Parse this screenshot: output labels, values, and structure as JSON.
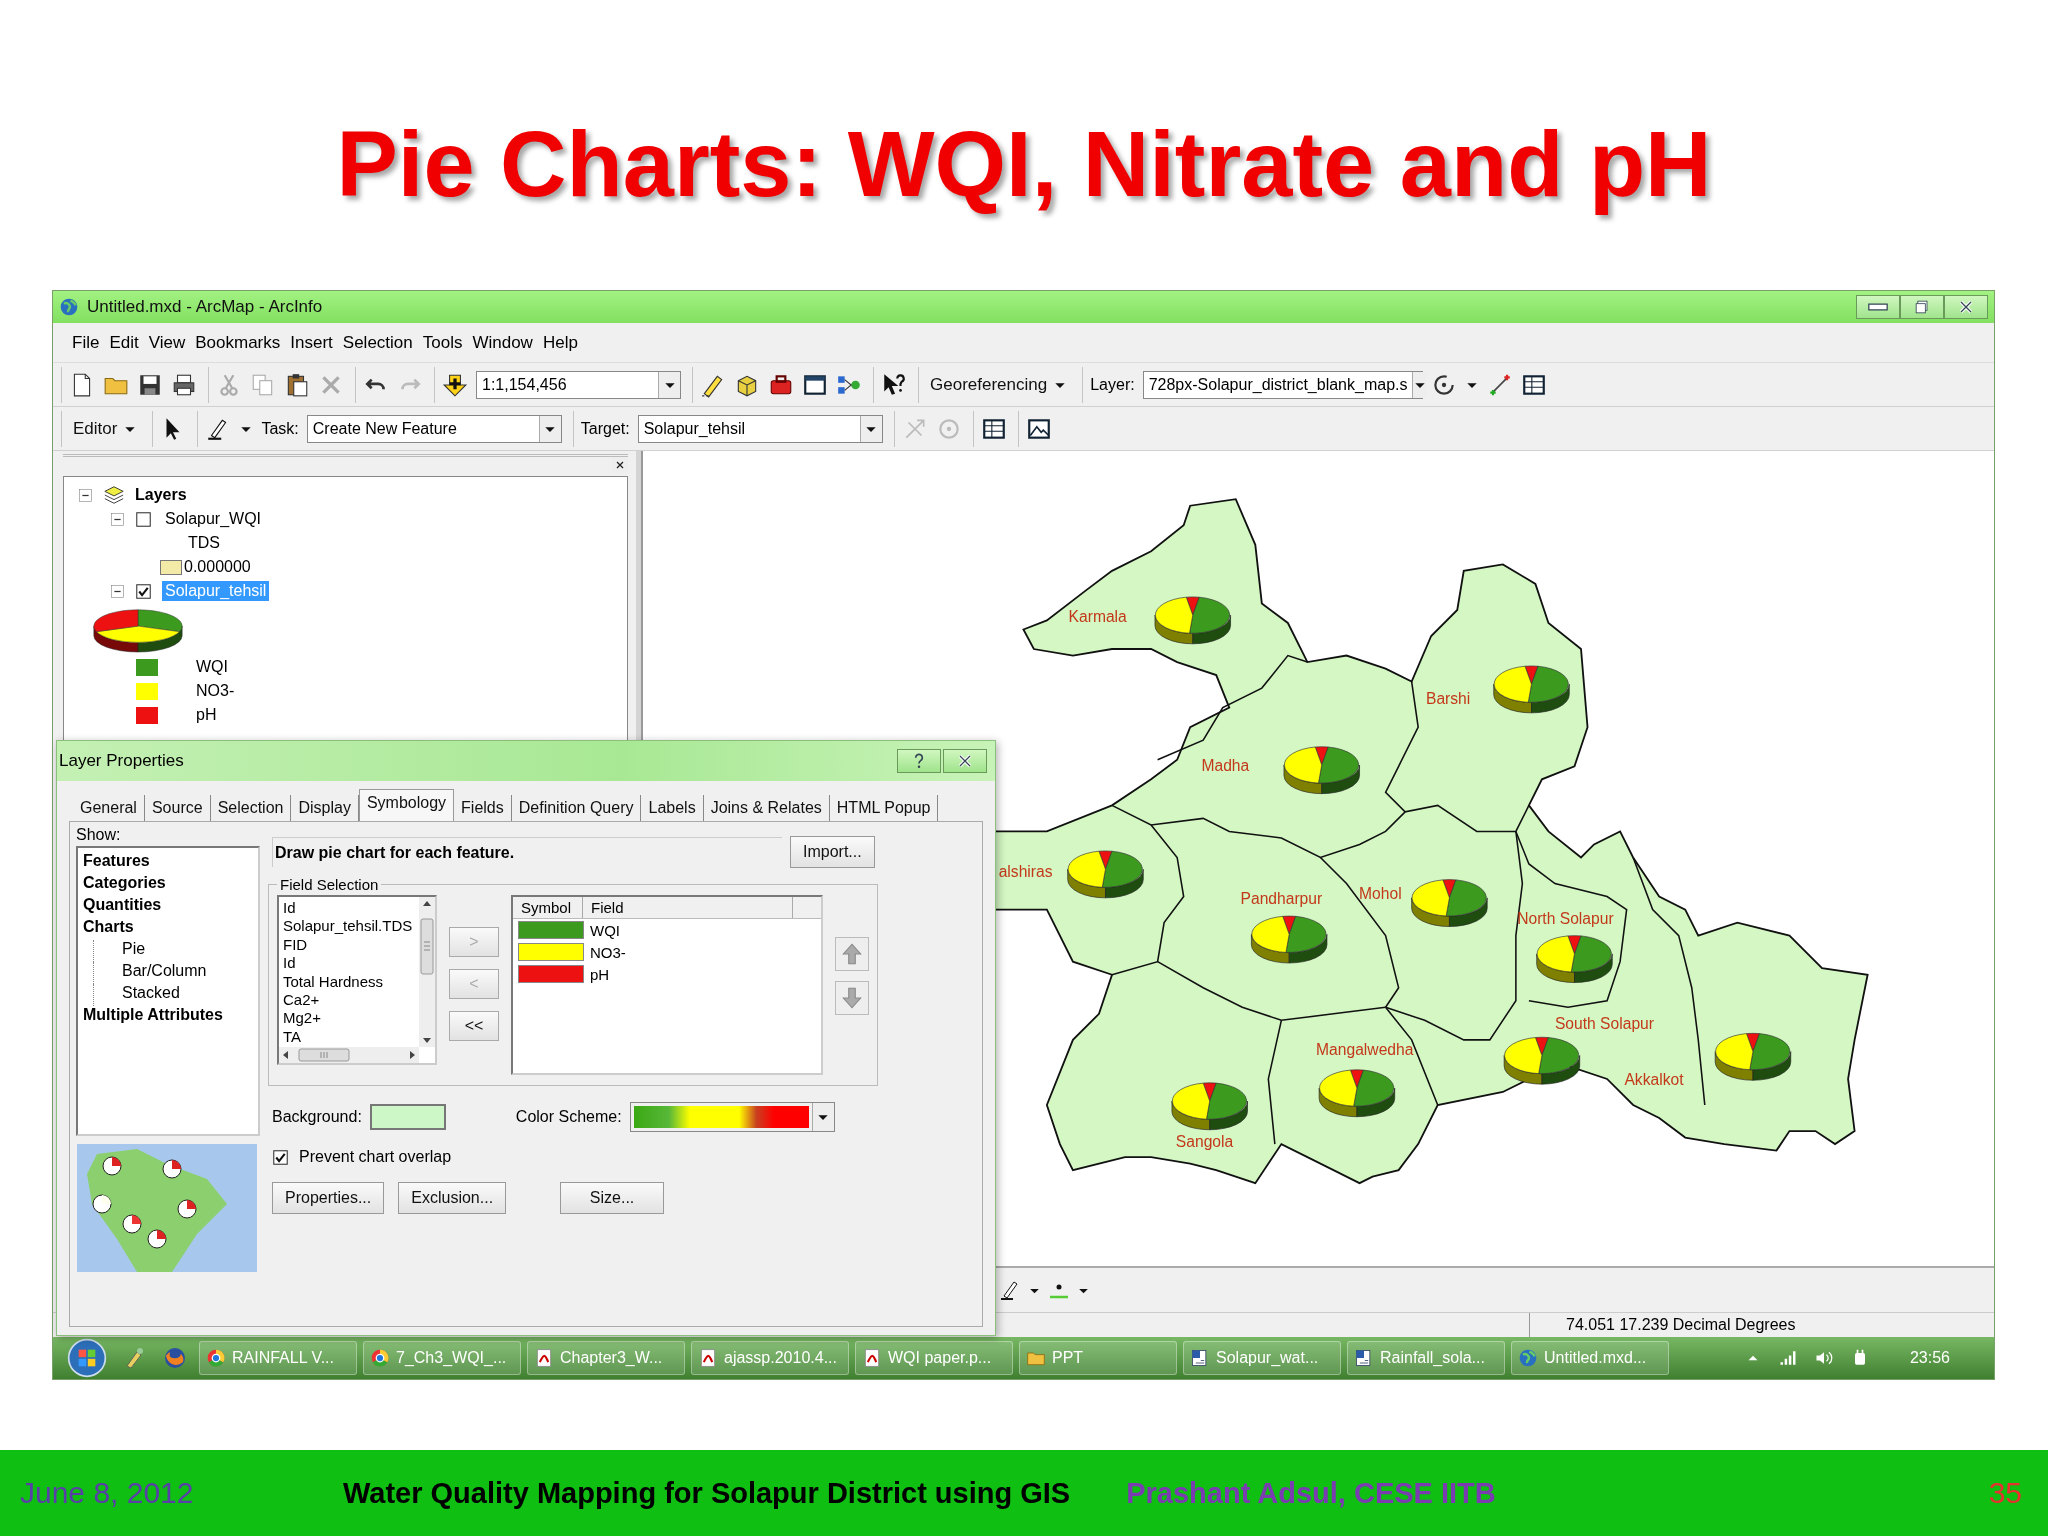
{
  "slide_title": "Pie Charts: WQI, Nitrate and pH",
  "window": {
    "title": "Untitled.mxd - ArcMap - ArcInfo"
  },
  "menu": [
    "File",
    "Edit",
    "View",
    "Bookmarks",
    "Insert",
    "Selection",
    "Tools",
    "Window",
    "Help"
  ],
  "toolbar": {
    "scale": "1:1,154,456",
    "georeferencing": "Georeferencing",
    "layer_label": "Layer:",
    "layer_value": "728px-Solapur_district_blank_map.s"
  },
  "editor_toolbar": {
    "editor": "Editor",
    "task_label": "Task:",
    "task_value": "Create New Feature",
    "target_label": "Target:",
    "target_value": "Solapur_tehsil"
  },
  "toc": {
    "root": "Layers",
    "layers": [
      {
        "name": "Solapur_WQI",
        "kind": "single",
        "checked": false,
        "selected": false,
        "expanded": true,
        "field": "TDS",
        "legend": [
          {
            "label": "0.000000",
            "color": "#f2eaa6"
          }
        ]
      },
      {
        "name": "Solapur_tehsil",
        "kind": "pie",
        "checked": true,
        "selected": true,
        "expanded": true,
        "legend": [
          {
            "label": "WQI",
            "color": "#3c9a1e"
          },
          {
            "label": "NO3-",
            "color": "#ffff00"
          },
          {
            "label": "pH",
            "color": "#ee1111"
          }
        ]
      }
    ]
  },
  "map": {
    "districts": [
      {
        "name": "Karmala"
      },
      {
        "name": "Barshi"
      },
      {
        "name": "Madha"
      },
      {
        "name": "alshiras"
      },
      {
        "name": "Pandharpur"
      },
      {
        "name": "Mohol"
      },
      {
        "name": "North Solapur"
      },
      {
        "name": "South Solapur"
      },
      {
        "name": "Akkalkot"
      },
      {
        "name": "Mangalwedha"
      },
      {
        "name": "Sangola"
      }
    ]
  },
  "dialog": {
    "title": "Layer Properties",
    "tabs": [
      {
        "label": "General",
        "selected": false
      },
      {
        "label": "Source",
        "selected": false
      },
      {
        "label": "Selection",
        "selected": false
      },
      {
        "label": "Display",
        "selected": false
      },
      {
        "label": "Symbology",
        "selected": true
      },
      {
        "label": "Fields",
        "selected": false
      },
      {
        "label": "Definition Query",
        "selected": false
      },
      {
        "label": "Labels",
        "selected": false
      },
      {
        "label": "Joins & Relates",
        "selected": false
      },
      {
        "label": "HTML Popup",
        "selected": false
      }
    ],
    "show_label": "Show:",
    "show_list": [
      {
        "label": "Features"
      },
      {
        "label": "Categories"
      },
      {
        "label": "Quantities"
      },
      {
        "label": "Charts",
        "children": [
          {
            "label": "Pie"
          },
          {
            "label": "Bar/Column"
          },
          {
            "label": "Stacked"
          }
        ]
      },
      {
        "label": "Multiple Attributes"
      }
    ],
    "description": "Draw pie chart for each feature.",
    "import_button": "Import...",
    "field_selection": "Field Selection",
    "available_fields": [
      "Id",
      "Solapur_tehsil.TDS",
      "FID",
      "Id",
      "Total Hardness",
      "Ca2+",
      "Mg2+",
      "TA"
    ],
    "move_buttons": [
      {
        "label": ">",
        "disabled": true
      },
      {
        "label": "<",
        "disabled": true
      },
      {
        "label": "<<",
        "disabled": false
      }
    ],
    "columns": [
      "Symbol",
      "Field"
    ],
    "selected_fields": [
      {
        "name": "WQI",
        "color": "#3c9a1e"
      },
      {
        "name": "NO3-",
        "color": "#ffff00"
      },
      {
        "name": "pH",
        "color": "#ee1111"
      }
    ],
    "background_label": "Background:",
    "color_scheme_label": "Color  Scheme:",
    "prevent_overlap": {
      "label": "Prevent chart overlap",
      "checked": true
    },
    "buttons": [
      "Properties...",
      "Exclusion...",
      "Size..."
    ]
  },
  "status_bar": "74.051  17.239 Decimal Degrees",
  "taskbar": {
    "items": [
      {
        "label": "RAINFALL V...",
        "kind": "browser"
      },
      {
        "label": "7_Ch3_WQI_...",
        "kind": "browser"
      },
      {
        "label": "Chapter3_W...",
        "kind": "pdf"
      },
      {
        "label": "ajassp.2010.4...",
        "kind": "pdf"
      },
      {
        "label": "WQI paper.p...",
        "kind": "pdf"
      },
      {
        "label": "PPT",
        "kind": "folder"
      },
      {
        "label": "Solapur_wat...",
        "kind": "doc"
      },
      {
        "label": "Rainfall_sola...",
        "kind": "doc"
      },
      {
        "label": "Untitled.mxd...",
        "kind": "arcmap"
      }
    ],
    "clock": "23:56"
  },
  "footer": {
    "date": "June 8, 2012",
    "title": "Water Quality Mapping for Solapur District using GIS",
    "author": "Prashant Adsul, CESE IITB",
    "page": "35"
  }
}
